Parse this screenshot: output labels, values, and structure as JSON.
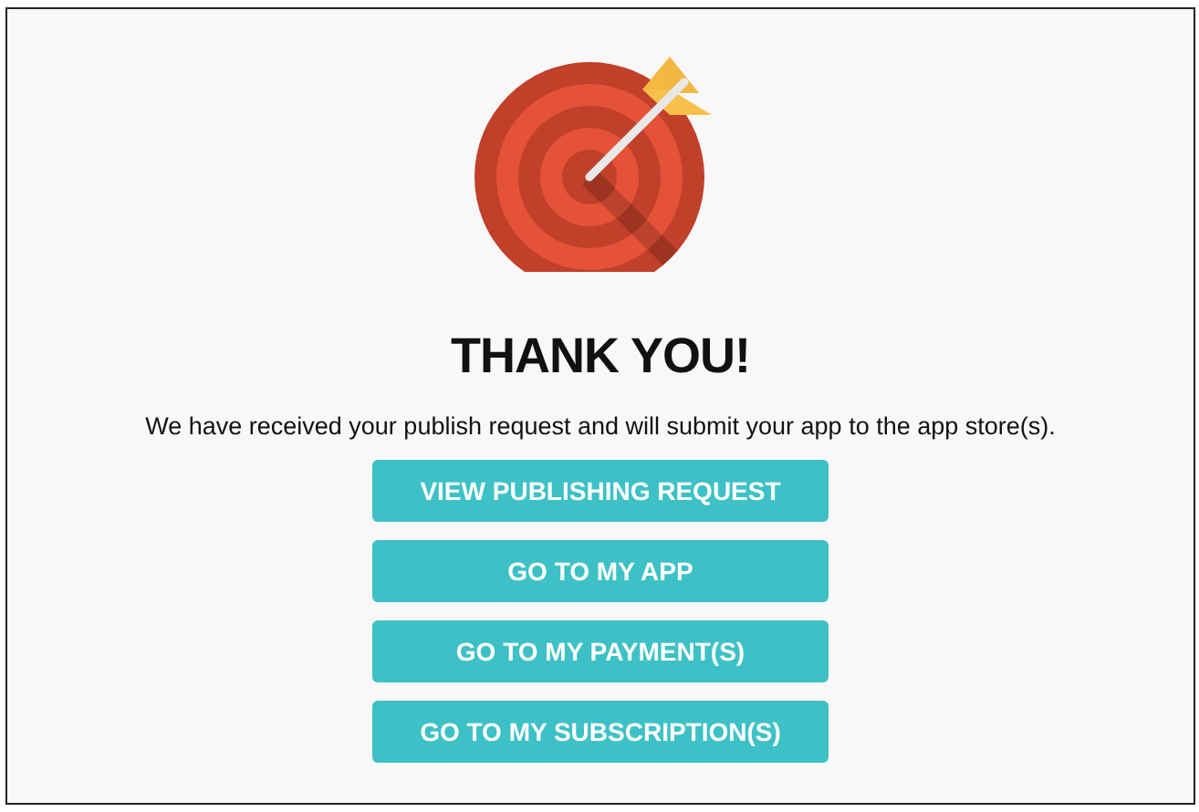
{
  "heading": "THANK YOU!",
  "message": "We have received your publish request and will submit your app to the app store(s).",
  "buttons": [
    "VIEW PUBLISHING REQUEST",
    "GO TO MY APP",
    "GO TO MY PAYMENT(S)",
    "GO TO MY SUBSCRIPTION(S)"
  ]
}
